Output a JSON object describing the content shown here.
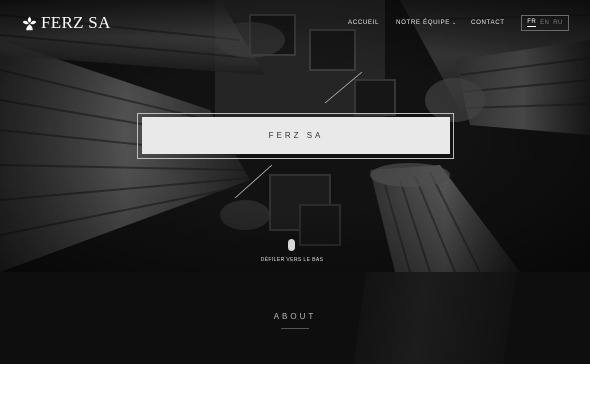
{
  "header": {
    "brand": "FERZ SA",
    "nav": [
      {
        "label": "ACCUEIL"
      },
      {
        "label": "NOTRE ÉQUIPE"
      },
      {
        "label": "CONTACT"
      }
    ],
    "languages": [
      "FR",
      "EN",
      "RU"
    ],
    "active_language": "FR"
  },
  "hero": {
    "title": "FERZ SA",
    "scroll_label": "DÉFILER VERS LE BAS"
  },
  "about": {
    "heading": "ABOUT"
  },
  "icons": {
    "logo": "fleur-icon",
    "scroll": "mouse-icon",
    "dropdown": "chevron-down-icon"
  },
  "colors": {
    "hero_overlay": "#141414",
    "title_box": "#e9e9e9",
    "about_band": "#0e0e0e",
    "text_light": "#e8e8e8"
  }
}
